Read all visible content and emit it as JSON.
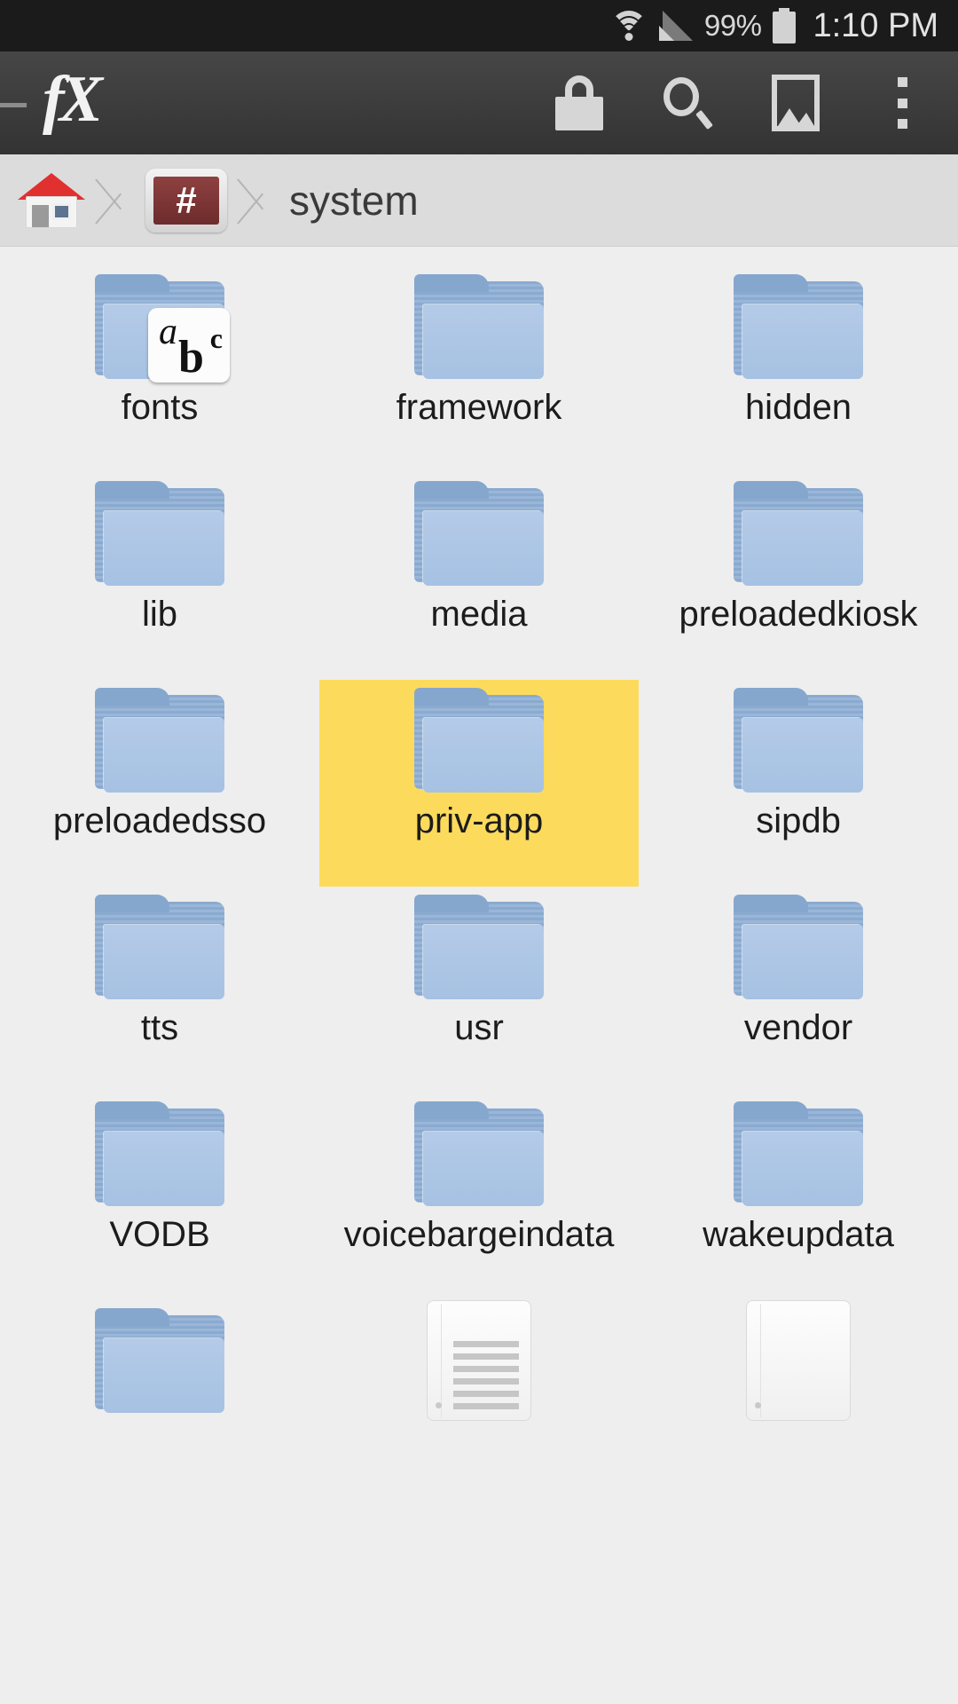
{
  "status_bar": {
    "wifi_icon": "wifi-icon",
    "signal_icon": "signal-icon",
    "battery_percent": "99%",
    "battery_icon": "battery-icon",
    "time": "1:10 PM"
  },
  "toolbar": {
    "app_logo": "fX",
    "actions": [
      {
        "name": "lock-icon",
        "label": "Lock"
      },
      {
        "name": "search-icon",
        "label": "Search"
      },
      {
        "name": "image-icon",
        "label": "Images"
      },
      {
        "name": "overflow-menu-icon",
        "label": "More options"
      }
    ]
  },
  "breadcrumb": {
    "home_icon": "home-icon",
    "root_icon_glyph": "#",
    "current_folder": "system"
  },
  "grid": {
    "items": [
      {
        "name": "fonts",
        "type": "folder",
        "badge": "abc",
        "selected": false
      },
      {
        "name": "framework",
        "type": "folder",
        "badge": null,
        "selected": false
      },
      {
        "name": "hidden",
        "type": "folder",
        "badge": null,
        "selected": false
      },
      {
        "name": "lib",
        "type": "folder",
        "badge": null,
        "selected": false
      },
      {
        "name": "media",
        "type": "folder",
        "badge": null,
        "selected": false
      },
      {
        "name": "preloadedkiosk",
        "type": "folder",
        "badge": null,
        "selected": false
      },
      {
        "name": "preloadedsso",
        "type": "folder",
        "badge": null,
        "selected": false
      },
      {
        "name": "priv-app",
        "type": "folder",
        "badge": null,
        "selected": true
      },
      {
        "name": "sipdb",
        "type": "folder",
        "badge": null,
        "selected": false
      },
      {
        "name": "tts",
        "type": "folder",
        "badge": null,
        "selected": false
      },
      {
        "name": "usr",
        "type": "folder",
        "badge": null,
        "selected": false
      },
      {
        "name": "vendor",
        "type": "folder",
        "badge": null,
        "selected": false
      },
      {
        "name": "VODB",
        "type": "folder",
        "badge": null,
        "selected": false
      },
      {
        "name": "voicebargeindata",
        "type": "folder",
        "badge": null,
        "selected": false
      },
      {
        "name": "wakeupdata",
        "type": "folder",
        "badge": null,
        "selected": false
      },
      {
        "name": "",
        "type": "folder",
        "badge": null,
        "selected": false
      },
      {
        "name": "",
        "type": "document",
        "badge": null,
        "selected": false
      },
      {
        "name": "",
        "type": "document-blank",
        "badge": null,
        "selected": false
      }
    ],
    "abc_badge": {
      "a": "a",
      "b": "b",
      "c": "c"
    }
  },
  "colors": {
    "selection": "#fcdb5c",
    "folder_back": "#8aaad0",
    "folder_front": "#a6c1e2",
    "background": "#eeeeee",
    "toolbar": "#3c3c3c",
    "status_bar": "#1b1b1b",
    "breadcrumb": "#dcdcdc",
    "root_icon": "#6d2b2b",
    "home_roof": "#e03030"
  }
}
